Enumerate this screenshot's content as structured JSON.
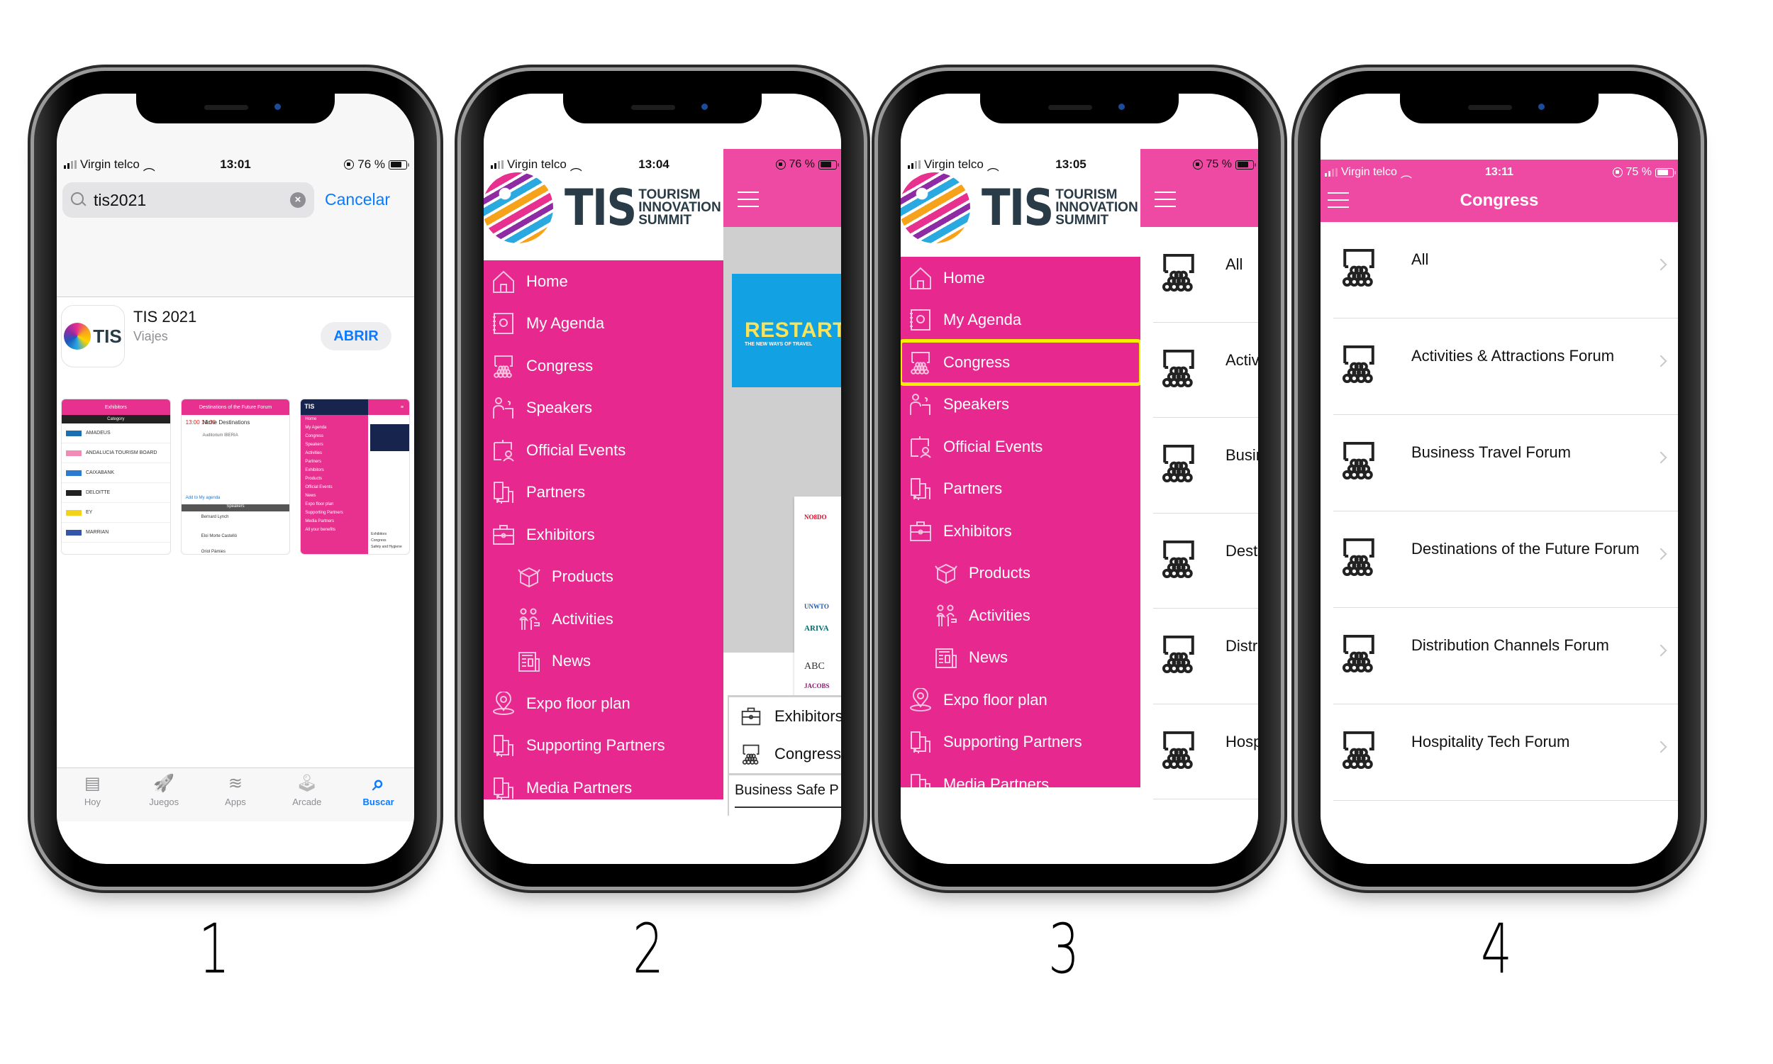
{
  "steps": [
    "1",
    "2",
    "3",
    "4"
  ],
  "colors": {
    "brand_pink": "#e6288f",
    "header_pink": "#ee4aa4",
    "ios_blue": "#0a7aff",
    "highlight_yellow": "#f6f000"
  },
  "phone1": {
    "status": {
      "carrier": "Virgin telco",
      "time": "13:01",
      "battery": "76 %",
      "battery_level": 0.76
    },
    "search": {
      "value": "tis2021",
      "cancel_label": "Cancelar"
    },
    "app": {
      "name": "TIS 2021",
      "category": "Viajes",
      "icon_text": "TIS",
      "open_label": "ABRIR"
    },
    "screenshots": [
      {
        "header": "Exhibitors",
        "subheader": "Category",
        "rows": [
          "AMADEUS",
          "ANDALUCIA TOURISM BOARD",
          "CAIXABANK",
          "DELOITTE",
          "EY",
          "MARRIAN"
        ]
      },
      {
        "header": "Destinations of the Future Forum",
        "session_time": "13:00 14:00",
        "session_title": "Niche Destinations",
        "venue": "Auditorium IBERIA",
        "add_label": "Add to My agenda",
        "section": "Speakers",
        "speakers": [
          "Bernard Lynch",
          "Eloi Morte Castelló",
          "Oriol Pàmies"
        ]
      },
      {
        "logo": "TIS",
        "menu": [
          "Home",
          "My Agenda",
          "Congress",
          "Speakers",
          "Activities",
          "Partners",
          "Exhibitors",
          "Products",
          "Official Events",
          "News",
          "Expo floor plan",
          "Supporting Partners",
          "Media Partners",
          "All your benefits"
        ],
        "quick": [
          "Exhibitors",
          "Congress",
          "Safety and Hygiene"
        ]
      }
    ],
    "tabs": [
      {
        "label": "Hoy",
        "icon": "today-icon",
        "glyph": "▤",
        "active": false
      },
      {
        "label": "Juegos",
        "icon": "rocket-icon",
        "glyph": "🚀",
        "active": false
      },
      {
        "label": "Apps",
        "icon": "layers-icon",
        "glyph": "≋",
        "active": false
      },
      {
        "label": "Arcade",
        "icon": "joystick-icon",
        "glyph": "🕹",
        "active": false
      },
      {
        "label": "Buscar",
        "icon": "search-icon",
        "glyph": "⌕",
        "active": true
      }
    ]
  },
  "logo": {
    "mark": "TIS",
    "line1": "TOURISM",
    "line2": "INNOVATION",
    "line3": "SUMMIT"
  },
  "menu": [
    {
      "label": "Home",
      "icon": "home-icon"
    },
    {
      "label": "My Agenda",
      "icon": "agenda-icon"
    },
    {
      "label": "Congress",
      "icon": "congress-icon"
    },
    {
      "label": "Speakers",
      "icon": "speakers-icon"
    },
    {
      "label": "Official Events",
      "icon": "official-events-icon"
    },
    {
      "label": "Partners",
      "icon": "partners-icon"
    },
    {
      "label": "Exhibitors",
      "icon": "briefcase-icon"
    },
    {
      "label": "Products",
      "icon": "box-icon",
      "sub": true
    },
    {
      "label": "Activities",
      "icon": "activities-icon",
      "sub": true
    },
    {
      "label": "News",
      "icon": "news-icon",
      "sub": true
    },
    {
      "label": "Expo floor plan",
      "icon": "map-pin-icon"
    },
    {
      "label": "Supporting Partners",
      "icon": "partners-icon"
    },
    {
      "label": "Media Partners",
      "icon": "partners-icon"
    }
  ],
  "phone2": {
    "status": {
      "carrier": "Virgin telco",
      "time": "13:04",
      "battery": "76 %",
      "battery_level": 0.76
    },
    "banner": {
      "title": "RESTART",
      "subtitle": "THE NEW WAYS OF TRAVEL"
    },
    "sponsor_logos": [
      "NO8DO",
      "UNWTO",
      "ARIVA",
      "ABC",
      "JACOBS"
    ],
    "quick_links": [
      {
        "label": "Exhibitors",
        "icon": "briefcase-icon"
      },
      {
        "label": "Congress",
        "icon": "congress-icon"
      }
    ],
    "news_preview": "Business Safe P"
  },
  "phone3": {
    "status": {
      "carrier": "Virgin telco",
      "time": "13:05",
      "battery": "75 %",
      "battery_level": 0.75
    },
    "highlighted_item": "Congress",
    "list_preview": [
      "All",
      "Activ",
      "Busin",
      "Desti",
      "Distri",
      "Hosp"
    ]
  },
  "phone4": {
    "status": {
      "carrier": "Virgin telco",
      "time": "13:11",
      "battery": "75 %",
      "battery_level": 0.75
    },
    "title": "Congress",
    "forums": [
      "All",
      "Activities & Attractions Forum",
      "Business Travel Forum",
      "Destinations of the Future Forum",
      "Distribution Channels Forum",
      "Hospitality Tech Forum"
    ]
  }
}
